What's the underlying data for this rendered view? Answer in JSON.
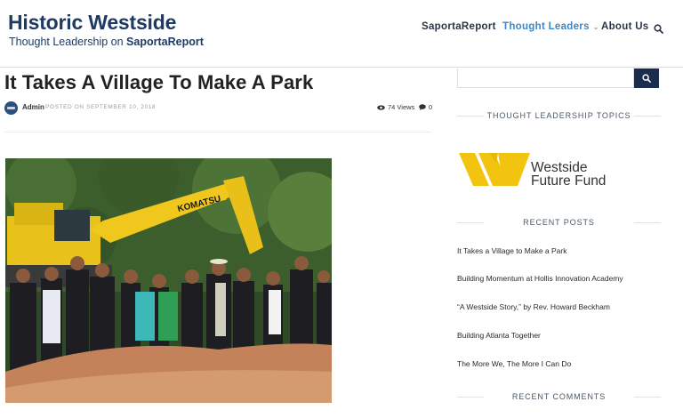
{
  "header": {
    "site_title": "Historic Westside",
    "tagline_prefix": "Thought Leadership on ",
    "tagline_brand": "SaportaReport",
    "nav": [
      {
        "label": "SaportaReport"
      },
      {
        "label": "Thought Leaders",
        "active": true,
        "caret": "⌄"
      },
      {
        "label": "About Us"
      }
    ],
    "search_icon": "search-icon"
  },
  "article": {
    "title": "It Takes A Village To Make A Park",
    "author": "Admin",
    "posted": "POSTED ON SEPTEMBER 10, 2018",
    "views": "74 Views",
    "comments": "0",
    "photo": {
      "machine_text": "KOMATSU"
    }
  },
  "sidebar": {
    "topics_heading": "THOUGHT LEADERSHIP TOPICS",
    "sponsor_line1": "Westside",
    "sponsor_line2": "Future Fund",
    "recent_posts_heading": "RECENT POSTS",
    "recent_posts": [
      "It Takes a Village to Make a Park",
      "Building Momentum at Hollis Innovation Academy",
      "“A Westside Story,” by Rev. Howard Beckham",
      "Building Atlanta Together",
      "The More We, The More I Can Do"
    ],
    "recent_comments_heading": "RECENT COMMENTS"
  },
  "colors": {
    "brand_navy": "#1f3a63",
    "nav_active": "#3d87c7",
    "search_button": "#1b2d4c",
    "sponsor_yellow": "#f2c40f"
  }
}
